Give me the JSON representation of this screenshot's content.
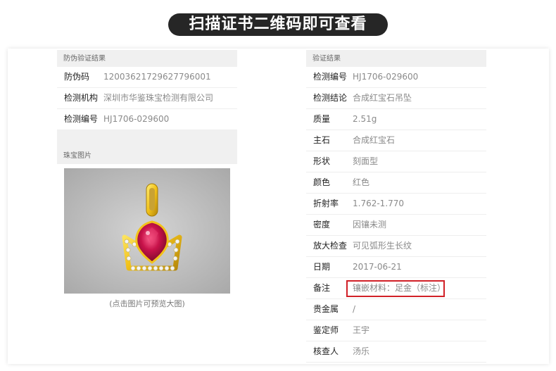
{
  "banner": "扫描证书二维码即可查看",
  "left": {
    "section1": "防伪验证结果",
    "rows": [
      {
        "k": "防伪码",
        "v": "12003621729627796001"
      },
      {
        "k": "检测机构",
        "v": "深圳市华鉴珠宝检测有限公司"
      },
      {
        "k": "检测编号",
        "v": "HJ1706-029600"
      }
    ],
    "section2": "珠宝图片",
    "caption": "(点击图片可预览大图)"
  },
  "right": {
    "section1": "验证结果",
    "rows": [
      {
        "k": "检测编号",
        "v": "HJ1706-029600"
      },
      {
        "k": "检测结论",
        "v": "合成红宝石吊坠"
      },
      {
        "k": "质量",
        "v": "2.51g"
      },
      {
        "k": "主石",
        "v": "合成红宝石"
      },
      {
        "k": "形状",
        "v": "刻面型"
      },
      {
        "k": "颜色",
        "v": "红色"
      },
      {
        "k": "折射率",
        "v": "1.762-1.770"
      },
      {
        "k": "密度",
        "v": "因镶未测"
      },
      {
        "k": "放大检查",
        "v": "可见弧形生长纹"
      },
      {
        "k": "日期",
        "v": "2017-06-21"
      },
      {
        "k": "备注",
        "v": "镶嵌材料：足金（标注）"
      },
      {
        "k": "贵金属",
        "v": "/"
      },
      {
        "k": "鉴定师",
        "v": "王宇"
      },
      {
        "k": "核查人",
        "v": "汤乐"
      }
    ]
  },
  "colors": {
    "highlight": "#d12027",
    "banner_bg": "#262626"
  }
}
